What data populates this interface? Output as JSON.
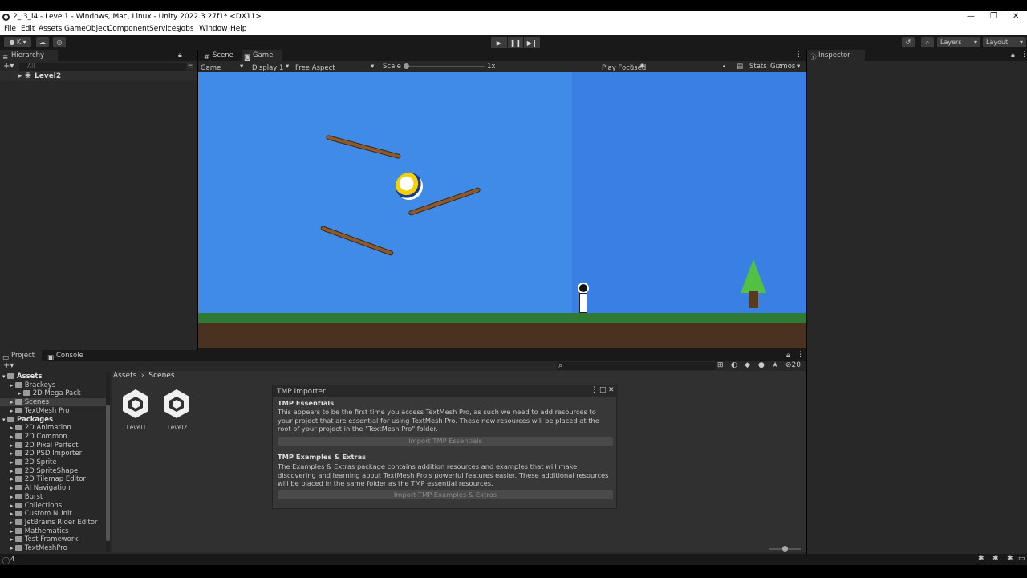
{
  "window": {
    "title": "2_l3_l4 - Level1 - Windows, Mac, Linux - Unity 2022.3.27f1* <DX11>",
    "minimize": "—",
    "maximize": "❐",
    "close": "✕"
  },
  "menu": [
    "File",
    "Edit",
    "Assets",
    "GameObject",
    "Component",
    "Services",
    "Jobs",
    "Window",
    "Help"
  ],
  "toolbar": {
    "account_label": "K",
    "layers_label": "Layers",
    "layout_label": "Layout"
  },
  "hierarchy": {
    "tab": "Hierarchy",
    "search_placeholder": "All",
    "root": "Level2"
  },
  "scene_tab": "Scene",
  "game_tab": "Game",
  "gamebar": {
    "mode": "Game",
    "display": "Display 1",
    "aspect": "Free Aspect",
    "scale_label": "Scale",
    "scale_value": "1x",
    "play_focused": "Play Focused",
    "stats": "Stats",
    "gizmos": "Gizmos"
  },
  "inspector": {
    "tab": "Inspector"
  },
  "project": {
    "tab": "Project",
    "console_tab": "Console",
    "breadcrumb": [
      "Assets",
      "Scenes"
    ],
    "count_badge": "20",
    "tree": [
      {
        "label": "Assets",
        "level": 0,
        "header": true
      },
      {
        "label": "Brackeys",
        "level": 1
      },
      {
        "label": "2D Mega Pack",
        "level": 2
      },
      {
        "label": "Scenes",
        "level": 1,
        "selected": true
      },
      {
        "label": "TextMesh Pro",
        "level": 1
      },
      {
        "label": "Packages",
        "level": 0,
        "header": true
      },
      {
        "label": "2D Animation",
        "level": 1
      },
      {
        "label": "2D Common",
        "level": 1
      },
      {
        "label": "2D Pixel Perfect",
        "level": 1
      },
      {
        "label": "2D PSD Importer",
        "level": 1
      },
      {
        "label": "2D Sprite",
        "level": 1
      },
      {
        "label": "2D SpriteShape",
        "level": 1
      },
      {
        "label": "2D Tilemap Editor",
        "level": 1
      },
      {
        "label": "AI Navigation",
        "level": 1
      },
      {
        "label": "Burst",
        "level": 1
      },
      {
        "label": "Collections",
        "level": 1
      },
      {
        "label": "Custom NUnit",
        "level": 1
      },
      {
        "label": "JetBrains Rider Editor",
        "level": 1
      },
      {
        "label": "Mathematics",
        "level": 1
      },
      {
        "label": "Test Framework",
        "level": 1
      },
      {
        "label": "TextMeshPro",
        "level": 1
      }
    ],
    "assets": [
      "Level1",
      "Level2"
    ]
  },
  "tmp_importer": {
    "title": "TMP Importer",
    "essentials_title": "TMP Essentials",
    "essentials_text": "This appears to be the first time you access TextMesh Pro, as such we need to add resources to your project that are essential for using TextMesh Pro. These new resources will be placed at the root of your project in the \"TextMesh Pro\" folder.",
    "essentials_button": "Import TMP Essentials",
    "examples_title": "TMP Examples & Extras",
    "examples_text": "The Examples & Extras package contains addition resources and examples that will make discovering and learning about TextMesh Pro's powerful features easier. These additional resources will be placed in the same folder as the TMP essential resources.",
    "examples_button": "Import TMP Examples & Extras"
  },
  "status": {
    "left": "4"
  },
  "colors": {
    "sky": "#418be8",
    "sky_right": "#3a80e4",
    "grass": "#2f7a34",
    "dirt": "#4a3220",
    "panel": "#282828"
  }
}
